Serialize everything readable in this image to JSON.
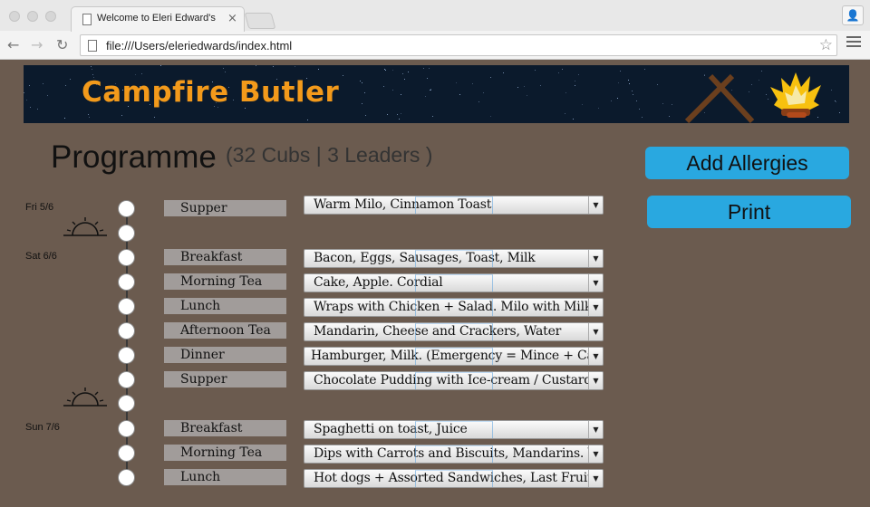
{
  "browser": {
    "tab_title": "Welcome to Eleri Edward's",
    "tab_close": "×",
    "url": "file:///Users/eleriedwards/index.html",
    "back_icon": "←",
    "forward_icon": "→",
    "reload_icon": "↻",
    "star_icon": "☆",
    "profile_icon": "👤"
  },
  "banner": {
    "title": "Campfire Butler",
    "colors": {
      "title": "#f39a1b",
      "background": "#0b1a2c"
    }
  },
  "programme": {
    "title": "Programme",
    "counts": "(32 Cubs | 3 Leaders )"
  },
  "actions": {
    "add_allergies": "Add Allergies",
    "print": "Print",
    "color": "#29a8e0"
  },
  "days": [
    {
      "label": "Fri 5/6"
    },
    {
      "label": "Sat 6/6"
    },
    {
      "label": "Sun 7/6"
    }
  ],
  "meals": [
    {
      "label": "Supper",
      "value": "Warm Milo, Cinnamon Toast"
    },
    {
      "label": "Breakfast",
      "value": "Bacon, Eggs, Sausages, Toast, Milk"
    },
    {
      "label": "Morning Tea",
      "value": "Cake, Apple. Cordial"
    },
    {
      "label": "Lunch",
      "value": "Wraps with Chicken + Salad. Milo with Milk"
    },
    {
      "label": "Afternoon Tea",
      "value": "Mandarin, Cheese and Crackers, Water"
    },
    {
      "label": "Dinner",
      "value": "Hamburger, Milk. (Emergency = Mince + Carrots)"
    },
    {
      "label": "Supper",
      "value": "Chocolate Pudding with Ice-cream / Custard"
    },
    {
      "label": "Breakfast",
      "value": "Spaghetti on toast, Juice"
    },
    {
      "label": "Morning Tea",
      "value": "Dips with Carrots and Biscuits, Mandarins. Water"
    },
    {
      "label": "Lunch",
      "value": "Hot dogs + Assorted Sandwiches, Last Fruits. Milo"
    }
  ],
  "icons": {
    "sunset": "sunset-icon",
    "sticks": "campfire-sticks-icon",
    "fire": "fire-icon",
    "dropdown": "▼"
  }
}
